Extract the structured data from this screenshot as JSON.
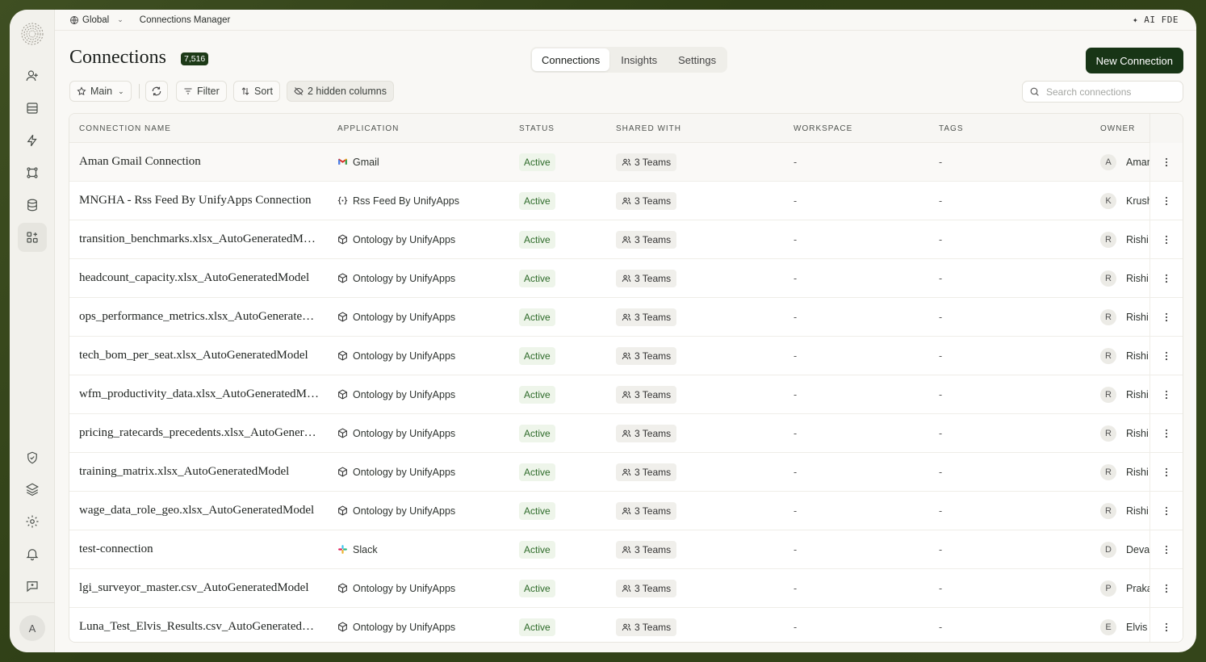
{
  "topbar": {
    "scope": "Global",
    "breadcrumb": "Connections Manager",
    "ai_label": "AI FDE"
  },
  "sidebar": {
    "items": [
      {
        "name": "users-icon"
      },
      {
        "name": "inbox-icon"
      },
      {
        "name": "bolt-icon"
      },
      {
        "name": "workflow-icon"
      },
      {
        "name": "database-icon"
      },
      {
        "name": "apps-add-icon",
        "active": true
      },
      {
        "name": "shield-check-icon"
      },
      {
        "name": "layers-icon"
      },
      {
        "name": "gear-icon"
      },
      {
        "name": "bell-icon"
      },
      {
        "name": "feedback-icon"
      }
    ],
    "user_initial": "A"
  },
  "header": {
    "title": "Connections",
    "count": "7,516",
    "tabs": [
      "Connections",
      "Insights",
      "Settings"
    ],
    "active_tab": "Connections",
    "new_button": "New Connection"
  },
  "toolbar": {
    "view": "Main",
    "filter": "Filter",
    "sort": "Sort",
    "hidden_columns": "2 hidden columns",
    "search_placeholder": "Search connections"
  },
  "table": {
    "columns": [
      "CONNECTION NAME",
      "APPLICATION",
      "STATUS",
      "SHARED WITH",
      "WORKSPACE",
      "TAGS",
      "OWNER"
    ],
    "rows": [
      {
        "name": "Aman Gmail Connection",
        "app": "Gmail",
        "app_icon": "gmail-icon",
        "status": "Active",
        "shared": "3 Teams",
        "workspace": "-",
        "tags": "-",
        "owner_initial": "A",
        "owner": "Aman"
      },
      {
        "name": "MNGHA - Rss Feed By UnifyApps Connection",
        "app": "Rss Feed By UnifyApps",
        "app_icon": "braces-icon",
        "status": "Active",
        "shared": "3 Teams",
        "workspace": "-",
        "tags": "-",
        "owner_initial": "K",
        "owner": "Krushna"
      },
      {
        "name": "transition_benchmarks.xlsx_AutoGeneratedModel",
        "app": "Ontology by UnifyApps",
        "app_icon": "cube-icon",
        "status": "Active",
        "shared": "3 Teams",
        "workspace": "-",
        "tags": "-",
        "owner_initial": "R",
        "owner": "Rishi"
      },
      {
        "name": "headcount_capacity.xlsx_AutoGeneratedModel",
        "app": "Ontology by UnifyApps",
        "app_icon": "cube-icon",
        "status": "Active",
        "shared": "3 Teams",
        "workspace": "-",
        "tags": "-",
        "owner_initial": "R",
        "owner": "Rishi"
      },
      {
        "name": "ops_performance_metrics.xlsx_AutoGeneratedModel",
        "app": "Ontology by UnifyApps",
        "app_icon": "cube-icon",
        "status": "Active",
        "shared": "3 Teams",
        "workspace": "-",
        "tags": "-",
        "owner_initial": "R",
        "owner": "Rishi"
      },
      {
        "name": "tech_bom_per_seat.xlsx_AutoGeneratedModel",
        "app": "Ontology by UnifyApps",
        "app_icon": "cube-icon",
        "status": "Active",
        "shared": "3 Teams",
        "workspace": "-",
        "tags": "-",
        "owner_initial": "R",
        "owner": "Rishi"
      },
      {
        "name": "wfm_productivity_data.xlsx_AutoGeneratedModel",
        "app": "Ontology by UnifyApps",
        "app_icon": "cube-icon",
        "status": "Active",
        "shared": "3 Teams",
        "workspace": "-",
        "tags": "-",
        "owner_initial": "R",
        "owner": "Rishi"
      },
      {
        "name": "pricing_ratecards_precedents.xlsx_AutoGeneratedModel",
        "app": "Ontology by UnifyApps",
        "app_icon": "cube-icon",
        "status": "Active",
        "shared": "3 Teams",
        "workspace": "-",
        "tags": "-",
        "owner_initial": "R",
        "owner": "Rishi"
      },
      {
        "name": "training_matrix.xlsx_AutoGeneratedModel",
        "app": "Ontology by UnifyApps",
        "app_icon": "cube-icon",
        "status": "Active",
        "shared": "3 Teams",
        "workspace": "-",
        "tags": "-",
        "owner_initial": "R",
        "owner": "Rishi"
      },
      {
        "name": "wage_data_role_geo.xlsx_AutoGeneratedModel",
        "app": "Ontology by UnifyApps",
        "app_icon": "cube-icon",
        "status": "Active",
        "shared": "3 Teams",
        "workspace": "-",
        "tags": "-",
        "owner_initial": "R",
        "owner": "Rishi"
      },
      {
        "name": "test-connection",
        "app": "Slack",
        "app_icon": "slack-icon",
        "status": "Active",
        "shared": "3 Teams",
        "workspace": "-",
        "tags": "-",
        "owner_initial": "D",
        "owner": "Deva"
      },
      {
        "name": "lgi_surveyor_master.csv_AutoGeneratedModel",
        "app": "Ontology by UnifyApps",
        "app_icon": "cube-icon",
        "status": "Active",
        "shared": "3 Teams",
        "workspace": "-",
        "tags": "-",
        "owner_initial": "P",
        "owner": "Prakash"
      },
      {
        "name": "Luna_Test_Elvis_Results.csv_AutoGeneratedModel",
        "app": "Ontology by UnifyApps",
        "app_icon": "cube-icon",
        "status": "Active",
        "shared": "3 Teams",
        "workspace": "-",
        "tags": "-",
        "owner_initial": "E",
        "owner": "Elvis"
      }
    ]
  }
}
